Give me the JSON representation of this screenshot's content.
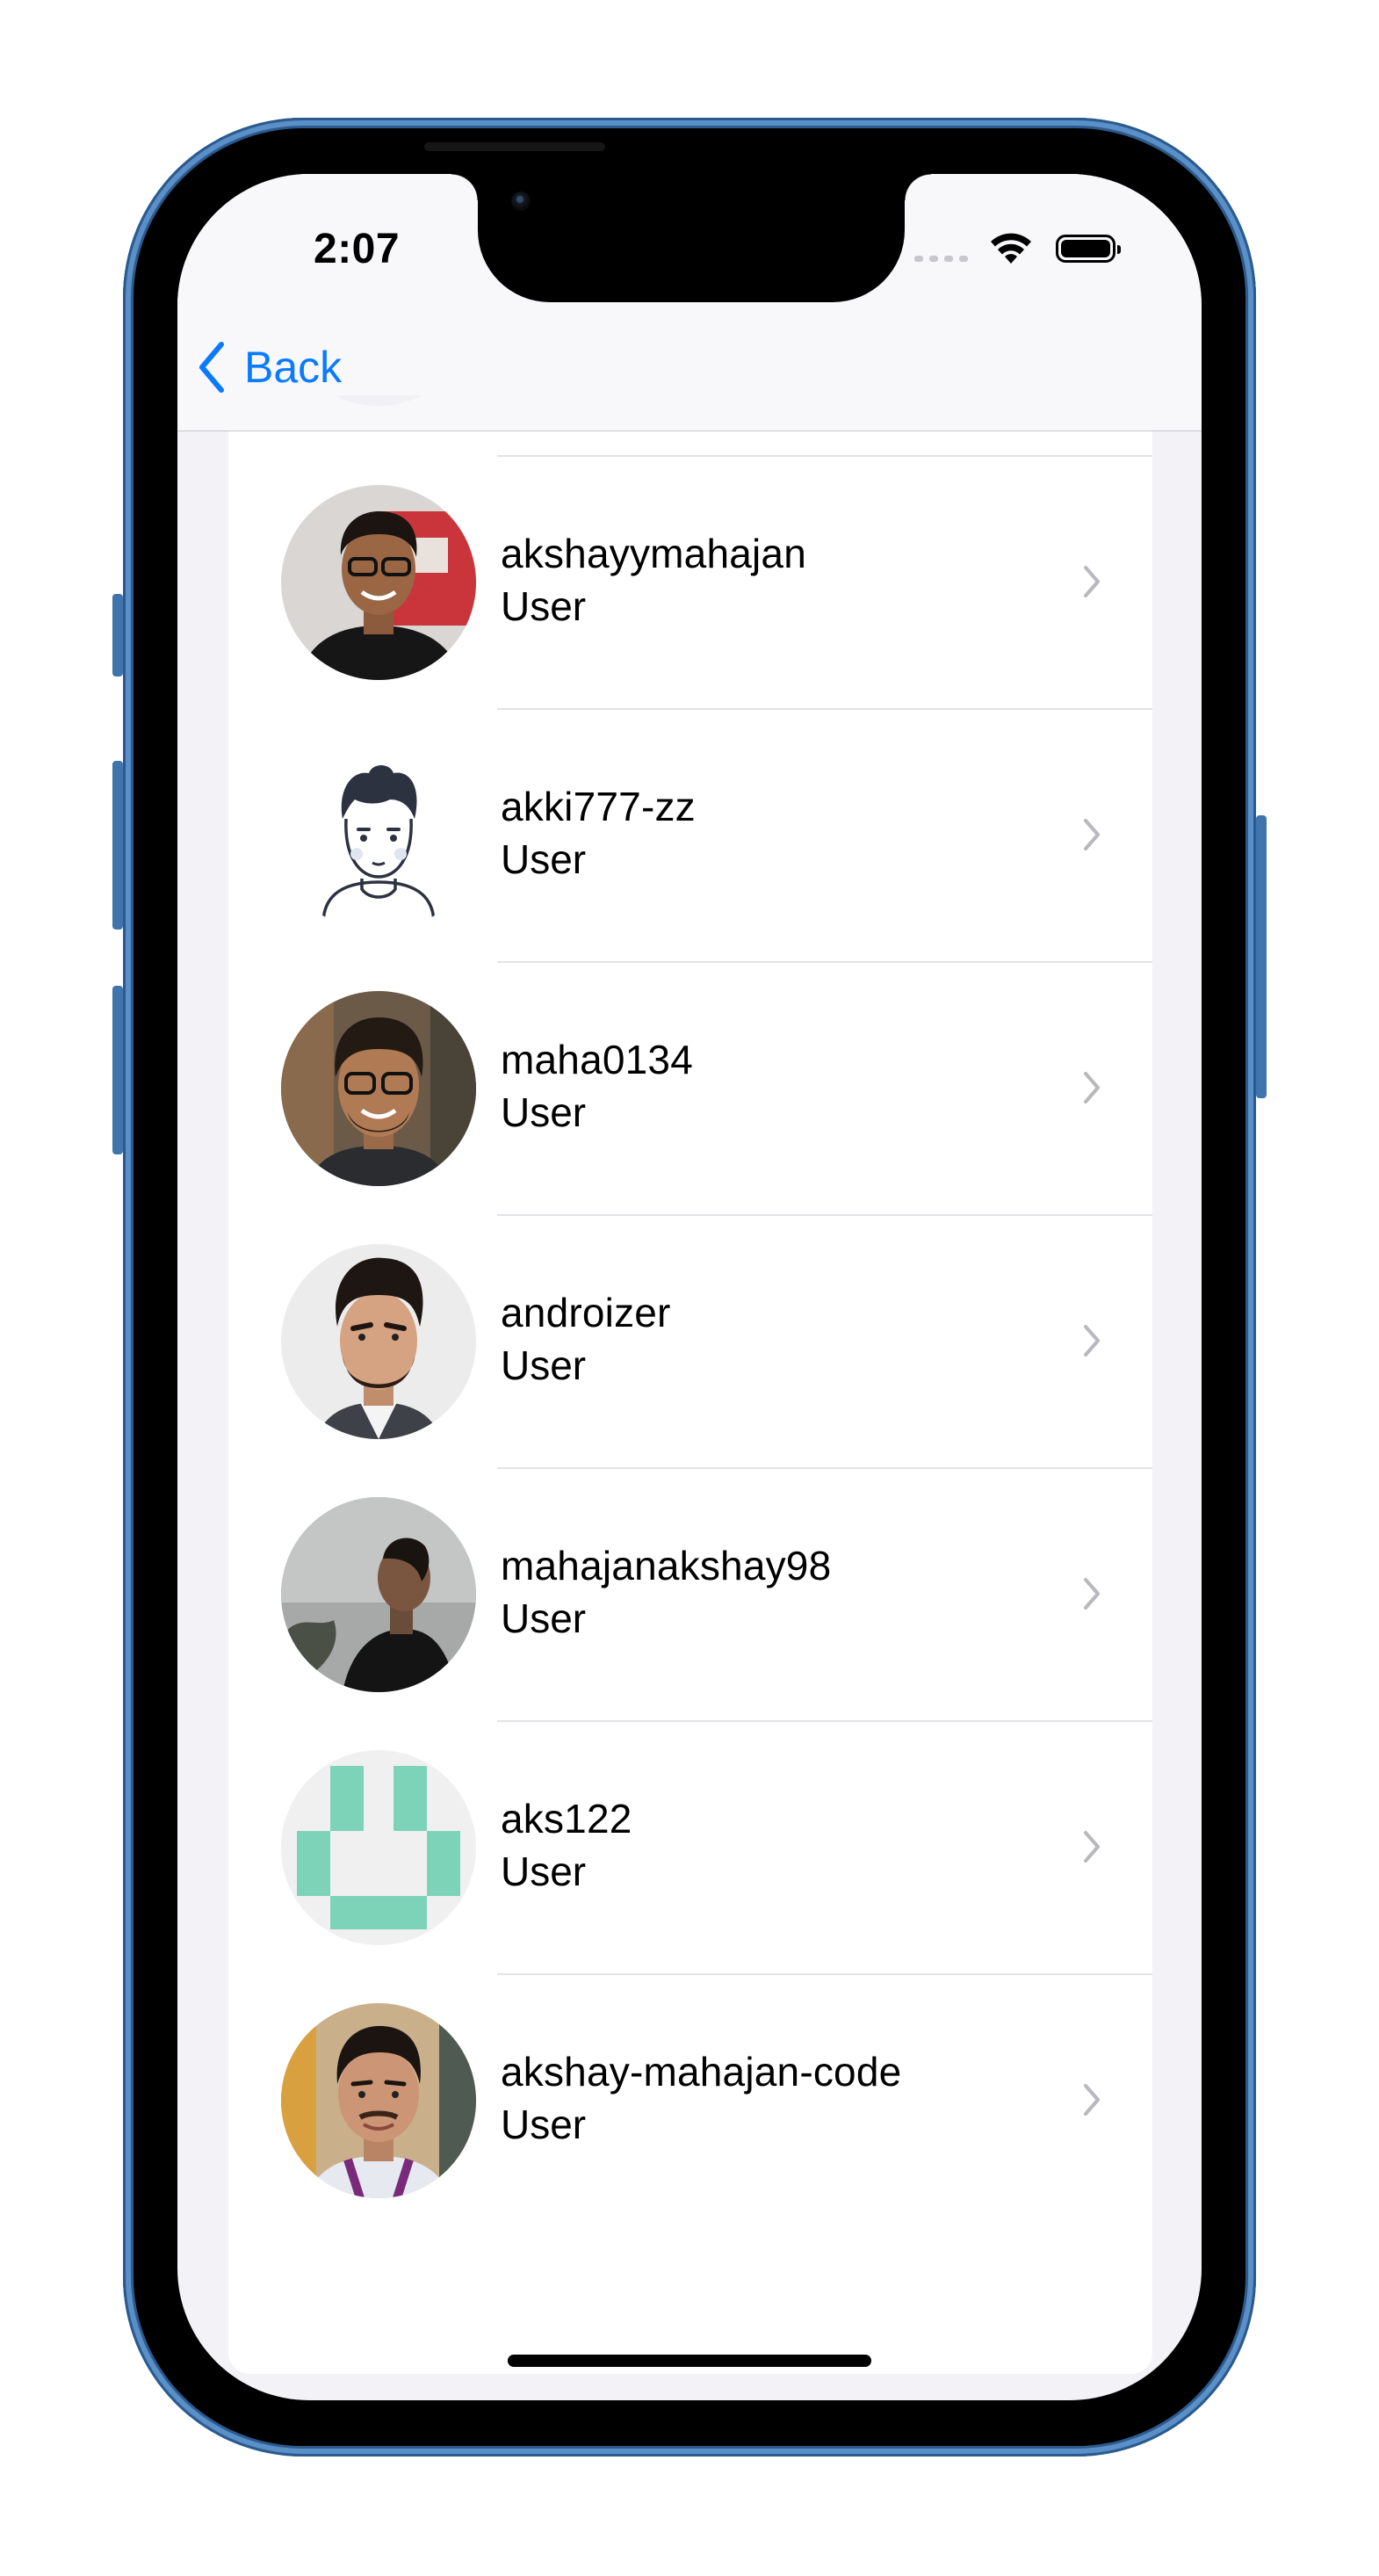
{
  "status_bar": {
    "time": "2:07"
  },
  "navbar": {
    "back_label": "Back"
  },
  "users": [
    {
      "name": "akshayymahajan",
      "role": "User",
      "avatar": "photo"
    },
    {
      "name": "akki777-zz",
      "role": "User",
      "avatar": "cartoon-illustration"
    },
    {
      "name": "maha0134",
      "role": "User",
      "avatar": "photo"
    },
    {
      "name": "androizer",
      "role": "User",
      "avatar": "photo"
    },
    {
      "name": "mahajanakshay98",
      "role": "User",
      "avatar": "photo"
    },
    {
      "name": "aks122",
      "role": "User",
      "avatar": "identicon"
    },
    {
      "name": "akshay-mahajan-code",
      "role": "User",
      "avatar": "photo"
    }
  ],
  "colors": {
    "accent": "#0a7bff",
    "background": "#f2f2f7",
    "identicon": "#7dd3b8",
    "device_frame": "#3a6da6"
  },
  "icons": [
    "chevron-left-icon",
    "chevron-right-icon",
    "wifi-icon",
    "battery-icon",
    "cellular-signal-icon"
  ]
}
